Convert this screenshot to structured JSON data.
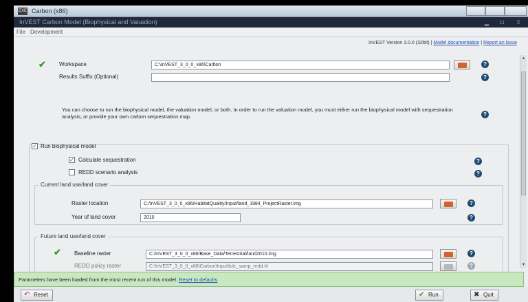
{
  "window": {
    "outer_title": "Carbon (x86)",
    "app_badge": "EXE",
    "inner_title": "InVEST Carbon Model (Biophysical and Valuation)",
    "min_glyph": "▁",
    "max_glyph": "□",
    "close_glyph": "X"
  },
  "menu": {
    "file": "File",
    "development": "Development"
  },
  "header": {
    "version": "InVEST Version 3.0.0 (32bit)",
    "sep": " | ",
    "doc_link": "Model documentation",
    "issue_link": "Report an issue"
  },
  "workspace": {
    "label": "Workspace",
    "value": "C:\\InVEST_3_0_0_x86\\Carbon"
  },
  "suffix": {
    "label": "Results Suffix (Optional)",
    "value": ""
  },
  "info_text": "You can choose to run the biophysical model, the valuation model, or both. In order to run the valuation model, you must either run the biophysical model with sequestration analysis, or provide your own carbon sequestration map.",
  "biophysical": {
    "label": "Run biophysical model",
    "checked": "✓",
    "calc_seq": {
      "label": "Calculate sequestration",
      "checked": "✓"
    },
    "redd": {
      "label": "REDD scenario analysis",
      "checked": ""
    }
  },
  "current_lulc": {
    "title": "Current land use/land cover",
    "raster_label": "Raster location",
    "raster_value": "C:/InVEST_3_0_0_x86/HabitatQuality/Input/land_1984_ProjectRaster.img",
    "year_label": "Year of land cover",
    "year_value": "2010"
  },
  "future_lulc": {
    "title": "Future land use/land cover",
    "baseline_label": "Baseline raster",
    "baseline_value": "C:/InVEST_3_0_0_x86/Base_Data/Terrestrial/land2010.img",
    "redd_label": "REDD policy raster",
    "redd_value": "C:\\InVEST_3_0_0_x86\\Carbon\\Input\\lulc_samp_redd.tif"
  },
  "status": {
    "message": "Parameters have been loaded from the most recent run of this model.",
    "reset_link": "Reset to defaults"
  },
  "buttons": {
    "reset": "Reset",
    "run": "Run",
    "quit": "Quit"
  },
  "icons": {
    "help_glyph": "?",
    "checkmark": "✔",
    "scroll_up": "▲",
    "scroll_down": "▼"
  },
  "colors": {
    "status_bg": "#c8e8c0",
    "check_green": "#3a9a2a",
    "help_blue": "#1f4b73",
    "folder_orange": "#d4622d",
    "link_blue": "#1f4fb5"
  }
}
